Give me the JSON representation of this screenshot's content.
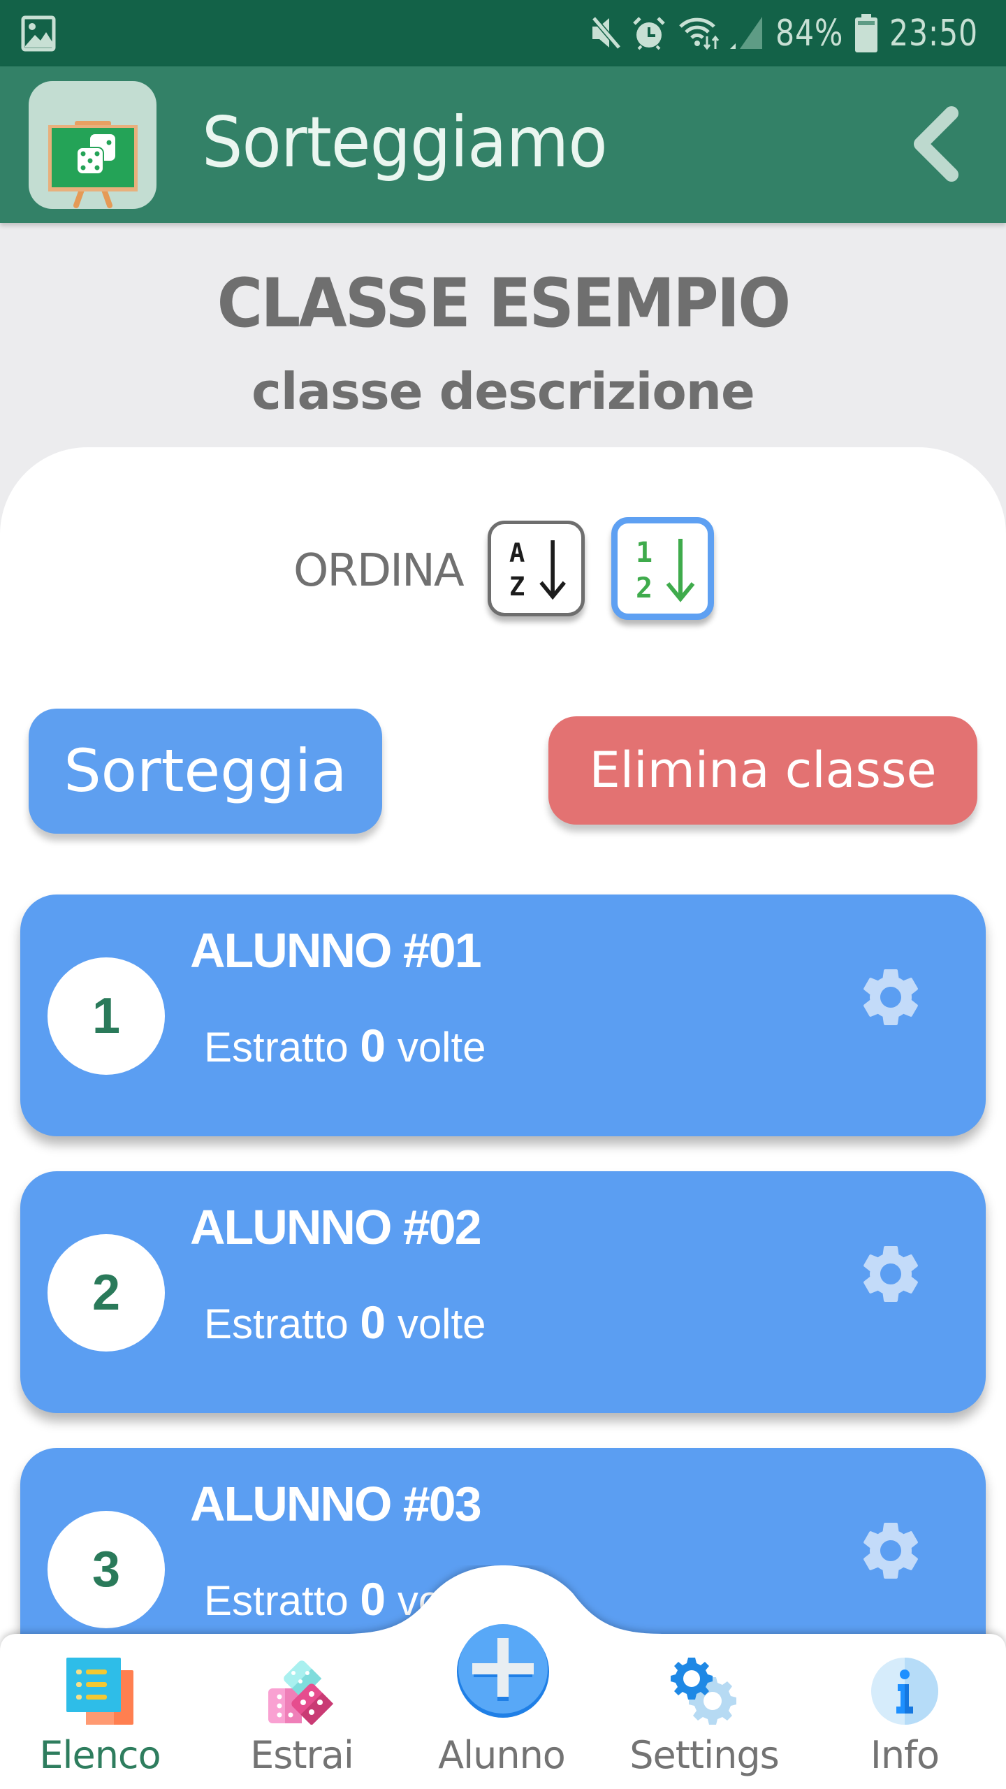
{
  "status_bar": {
    "battery_percent": "84%",
    "time": "23:50",
    "icons": [
      "image-notification-icon",
      "mute-icon",
      "alarm-icon",
      "wifi-icon",
      "signal-icon",
      "battery-icon"
    ]
  },
  "header": {
    "title": "Sorteggiamo",
    "app_icon": "chalkboard-dice-icon",
    "back_icon": "chevron-left-icon"
  },
  "class": {
    "title": "CLASSE ESEMPIO",
    "description": "classe descrizione"
  },
  "sort": {
    "label": "ORDINA",
    "options": [
      {
        "name": "alphabetical",
        "top": "A",
        "bottom": "Z",
        "selected": false
      },
      {
        "name": "numeric",
        "top": "1",
        "bottom": "2",
        "selected": true
      }
    ]
  },
  "actions": {
    "draw_label": "Sorteggia",
    "delete_label": "Elimina classe"
  },
  "students": [
    {
      "number": "1",
      "name": "ALUNNO #01",
      "count_prefix": "Estratto",
      "count": "0",
      "count_suffix": "volte"
    },
    {
      "number": "2",
      "name": "ALUNNO #02",
      "count_prefix": "Estratto",
      "count": "0",
      "count_suffix": "volte"
    },
    {
      "number": "3",
      "name": "ALUNNO #03",
      "count_prefix": "Estratto",
      "count": "0",
      "count_suffix": "volte"
    }
  ],
  "bottom_nav": {
    "items": [
      {
        "label": "Elenco",
        "icon": "list-icon",
        "active": true
      },
      {
        "label": "Estrai",
        "icon": "dice-icon",
        "active": false
      },
      {
        "label": "Alunno",
        "icon": "add-icon",
        "active": false
      },
      {
        "label": "Settings",
        "icon": "gears-icon",
        "active": false
      },
      {
        "label": "Info",
        "icon": "info-icon",
        "active": false
      }
    ]
  },
  "colors": {
    "status_bar": "#136248",
    "header": "#338167",
    "accent_green": "#2e7d5e",
    "card_blue": "#5b9ef2",
    "draw_button": "#5e9ff0",
    "delete_button": "#e37272"
  }
}
